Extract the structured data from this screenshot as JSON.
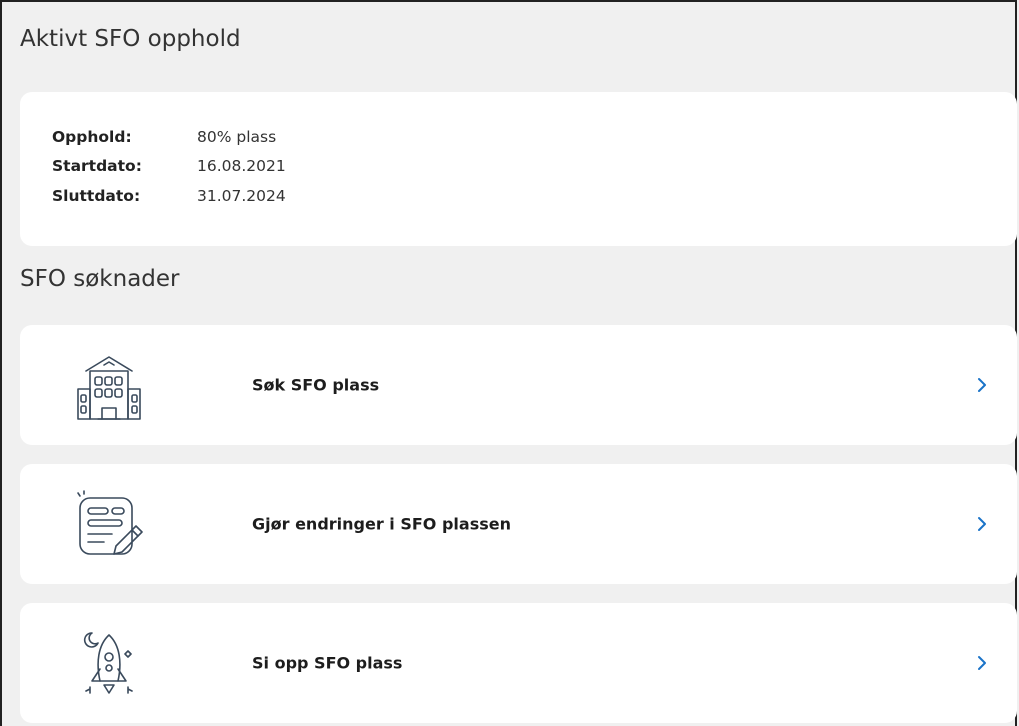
{
  "active_stay": {
    "title": "Aktivt SFO opphold",
    "rows": [
      {
        "label": "Opphold:",
        "value": "80% plass"
      },
      {
        "label": "Startdato:",
        "value": "16.08.2021"
      },
      {
        "label": "Sluttdato:",
        "value": "31.07.2024"
      }
    ]
  },
  "applications": {
    "title": "SFO søknader",
    "actions": [
      {
        "label": "Søk SFO plass",
        "icon": "school-building-icon"
      },
      {
        "label": "Gjør endringer i SFO plassen",
        "icon": "form-edit-icon"
      },
      {
        "label": "Si opp SFO plass",
        "icon": "rocket-icon"
      }
    ]
  },
  "colors": {
    "background": "#f0f0f0",
    "card": "#ffffff",
    "chevron": "#1a73c8",
    "icon_stroke": "#3a4a5c"
  }
}
